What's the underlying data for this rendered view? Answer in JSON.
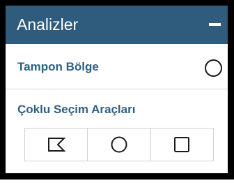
{
  "panel": {
    "title": "Analizler",
    "collapse_icon": "minus-icon",
    "header_color": "#2f5b7d",
    "label_color": "#2e6180"
  },
  "buffer": {
    "label": "Tampon Bölge",
    "toggle_icon": "circle-toggle-icon"
  },
  "multi_select": {
    "label": "Çoklu Seçim Araçları",
    "tools": [
      {
        "icon": "polygon-select-icon"
      },
      {
        "icon": "circle-select-icon"
      },
      {
        "icon": "rectangle-select-icon"
      }
    ]
  }
}
